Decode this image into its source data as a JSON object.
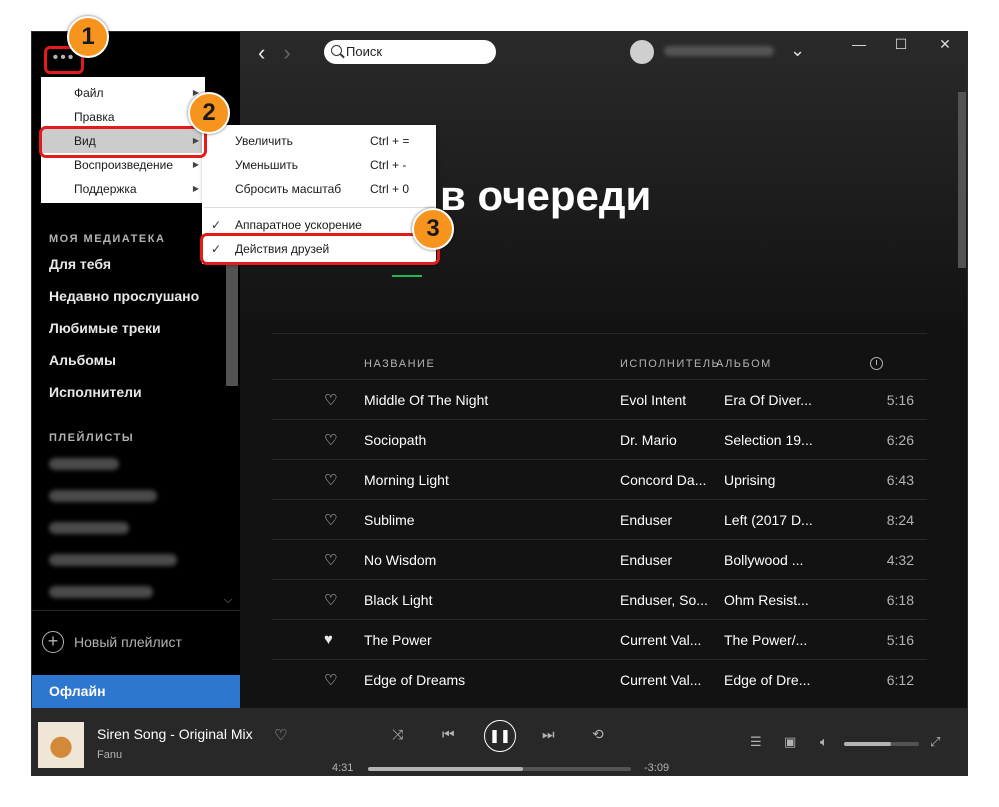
{
  "sidebar": {
    "menu_icon": "dots-menu-icon",
    "library_label": "МОЯ МЕДИАТЕКА",
    "library_items": [
      "Для тебя",
      "Недавно прослушано",
      "Любимые треки",
      "Альбомы",
      "Исполнители"
    ],
    "playlists_label": "ПЛЕЙЛИСТЫ",
    "new_playlist": "Новый плейлист",
    "offline": "Офлайн"
  },
  "topbar": {
    "search_placeholder": "Поиск",
    "back_icon": "‹",
    "forward_icon": "›",
    "dropdown_icon": "⌄",
    "minimize": "—",
    "maximize": "☐",
    "close": "✕"
  },
  "main": {
    "title": "в очереди",
    "columns": {
      "title": "НАЗВАНИЕ",
      "artist": "ИСПОЛНИТЕЛЬ",
      "album": "АЛЬБОМ"
    },
    "tracks": [
      {
        "title": "Middle Of The Night",
        "artist": "Evol Intent",
        "album": "Era Of Diver...",
        "duration": "5:16",
        "liked": false
      },
      {
        "title": "Sociopath",
        "artist": "Dr. Mario",
        "album": "Selection 19...",
        "duration": "6:26",
        "liked": false
      },
      {
        "title": "Morning Light",
        "artist": "Concord Da...",
        "album": "Uprising",
        "duration": "6:43",
        "liked": false
      },
      {
        "title": "Sublime",
        "artist": "Enduser",
        "album": "Left (2017 D...",
        "duration": "8:24",
        "liked": false
      },
      {
        "title": "No Wisdom",
        "artist": "Enduser",
        "album": "Bollywood ...",
        "duration": "4:32",
        "liked": false
      },
      {
        "title": "Black Light",
        "artist": "Enduser, So...",
        "album": "Ohm Resist...",
        "duration": "6:18",
        "liked": false
      },
      {
        "title": "The Power",
        "artist": "Current Val...",
        "album": "The Power/...",
        "duration": "5:16",
        "liked": true
      },
      {
        "title": "Edge of Dreams",
        "artist": "Current Val...",
        "album": "Edge of Dre...",
        "duration": "6:12",
        "liked": false
      }
    ]
  },
  "menu": {
    "items": [
      "Файл",
      "Правка",
      "Вид",
      "Воспроизведение",
      "Поддержка"
    ],
    "submenu": [
      {
        "label": "Увеличить",
        "shortcut": "Ctrl + ="
      },
      {
        "label": "Уменьшить",
        "shortcut": "Ctrl + -"
      },
      {
        "label": "Сбросить масштаб",
        "shortcut": "Ctrl + 0"
      },
      {
        "label": "Аппаратное ускорение",
        "checked": true
      },
      {
        "label": "Действия друзей",
        "checked": true
      }
    ]
  },
  "player": {
    "song": "Siren Song - Original Mix",
    "artist": "Fanu",
    "elapsed": "4:31",
    "remaining": "-3:09",
    "progress": 0.59,
    "volume": 0.62
  },
  "callouts": [
    "1",
    "2",
    "3"
  ],
  "colors": {
    "accent_green": "#1db954",
    "offline_blue": "#2e77d0",
    "highlight_red": "#e31b1b",
    "badge_orange": "#f7941d"
  }
}
